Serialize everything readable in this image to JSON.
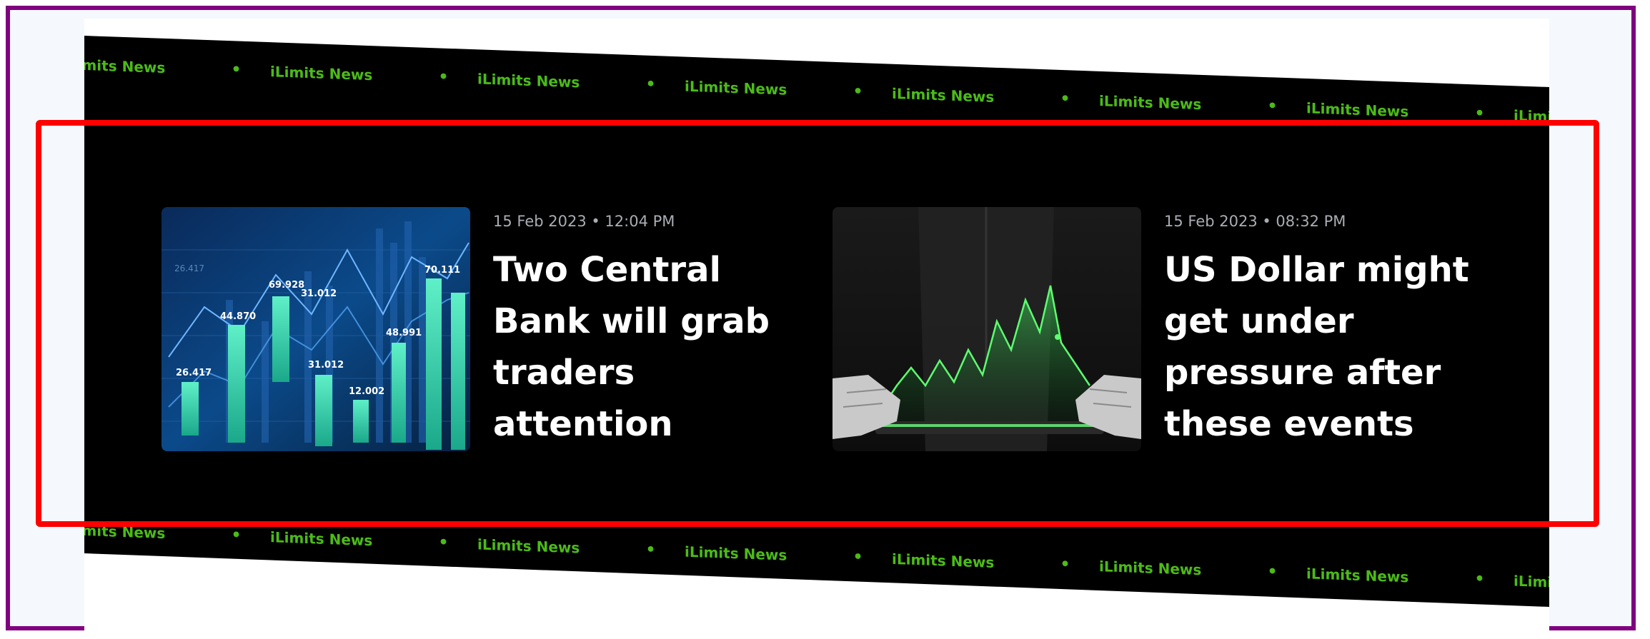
{
  "ticker": {
    "items": [
      "iLimits News",
      "iLimits News",
      "iLimits News",
      "iLimits News",
      "iLimits News",
      "iLimits News",
      "iLimits News",
      "iLimits News"
    ],
    "separator": "•"
  },
  "articles": [
    {
      "date": "15 Feb 2023 • 12:04 PM",
      "title": "Two Central Bank will grab traders attention",
      "image": {
        "icon": "stock-chart-image",
        "labels": [
          "26.417",
          "44.870",
          "69.928",
          "31.012",
          "31.012",
          "12.002",
          "48.991",
          "70.111",
          "26.417"
        ]
      }
    },
    {
      "date": "15 Feb 2023 • 08:32 PM",
      "title": "US Dollar might get under pressure after these events",
      "image": {
        "icon": "hands-tablet-chart-image"
      }
    }
  ],
  "colors": {
    "ticker_green": "#4cbb17",
    "banner_bg": "#000000",
    "frame": "#800080",
    "highlight": "#ff0000"
  }
}
